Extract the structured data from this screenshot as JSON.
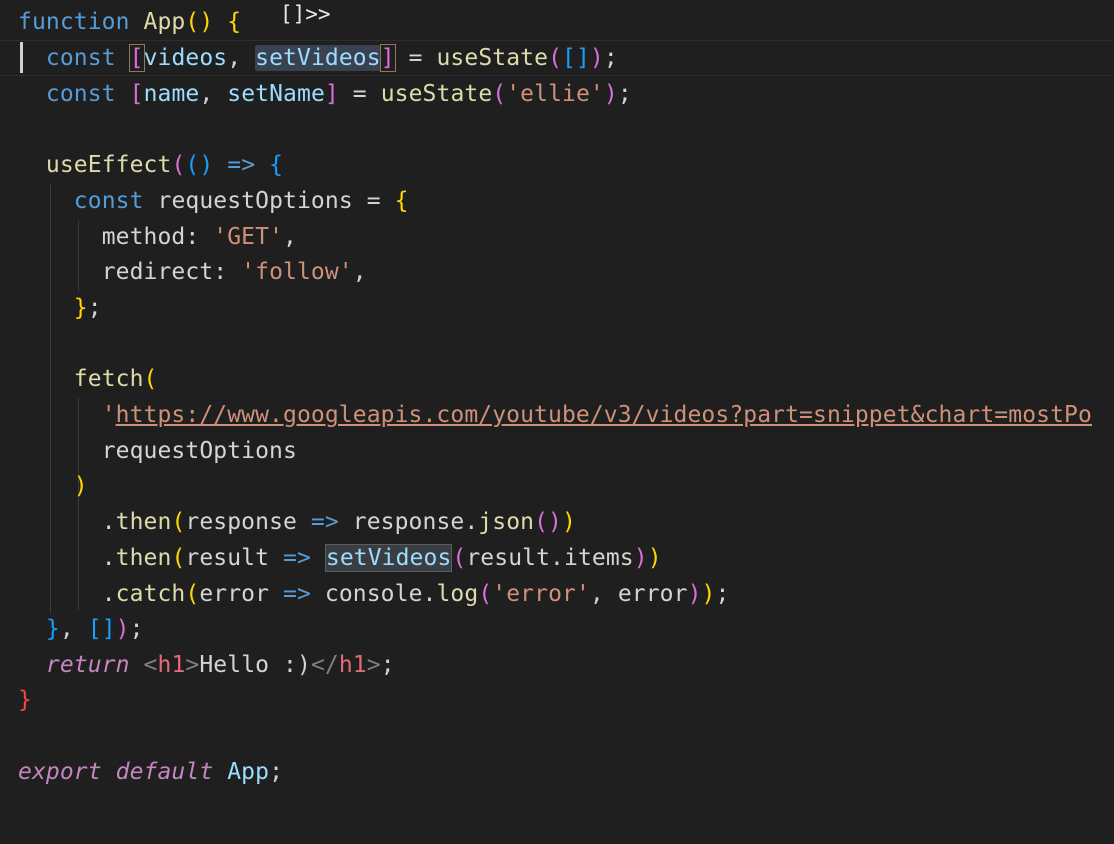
{
  "editor": {
    "inline_hint": "[]>>",
    "colors": {
      "background": "#1f1f1f",
      "keyword": "#569cd6",
      "function": "#dcdcaa",
      "variable": "#9cdcfe",
      "string": "#ce9178",
      "bracket_gold": "#ffd700",
      "bracket_purple": "#da70d6",
      "bracket_blue": "#179fff",
      "unmatched_brace": "#f44747"
    }
  },
  "code": {
    "l1": {
      "kw": "function",
      "name": "App",
      "open": "()",
      "brace": "{"
    },
    "l2": {
      "kw": "const",
      "open": "[",
      "a": "videos",
      "comma": ", ",
      "b": "setVideos",
      "close": "]",
      "eq": " = ",
      "fn": "useState",
      "p1": "(",
      "arr": "[]",
      "p2": ")",
      "semi": ";"
    },
    "l3": {
      "kw": "const",
      "open": "[",
      "a": "name",
      "comma": ", ",
      "b": "setName",
      "close": "]",
      "eq": " = ",
      "fn": "useState",
      "p1": "(",
      "str": "'ellie'",
      "p2": ")",
      "semi": ";"
    },
    "l5": {
      "fn": "useEffect",
      "p1": "(",
      "args": "()",
      "arrow": " => ",
      "brace": "{"
    },
    "l6": {
      "kw": "const",
      "name": "requestOptions",
      "eq": " = ",
      "brace": "{"
    },
    "l7": {
      "key": "method",
      "colon": ": ",
      "str": "'GET'",
      "comma": ","
    },
    "l8": {
      "key": "redirect",
      "colon": ": ",
      "str": "'follow'",
      "comma": ","
    },
    "l9": {
      "brace": "}",
      "semi": ";"
    },
    "l11": {
      "fn": "fetch",
      "p1": "("
    },
    "l12": {
      "quote": "'",
      "url": "https://www.googleapis.com/youtube/v3/videos?part=snippet&chart=mostPo"
    },
    "l13": {
      "arg": "requestOptions"
    },
    "l14": {
      "p2": ")"
    },
    "l15": {
      "dot": ".",
      "fn": "then",
      "p1": "(",
      "arg": "response",
      "arrow": " => ",
      "obj": "response",
      "dot2": ".",
      "fn2": "json",
      "call": "()",
      "p2": ")"
    },
    "l16": {
      "dot": ".",
      "fn": "then",
      "p1": "(",
      "arg": "result",
      "arrow": " => ",
      "fn2": "setVideos",
      "p3": "(",
      "obj": "result",
      "dot2": ".",
      "prop": "items",
      "p4": ")",
      "p2": ")"
    },
    "l17": {
      "dot": ".",
      "fn": "catch",
      "p1": "(",
      "arg": "error",
      "arrow": " => ",
      "obj": "console",
      "dot2": ".",
      "fn2": "log",
      "p3": "(",
      "str": "'error'",
      "comma": ", ",
      "arg2": "error",
      "p4": ")",
      "p2": ")",
      "semi": ";"
    },
    "l18": {
      "brace": "}",
      "comma": ", ",
      "arr": "[]",
      "p2": ")",
      "semi": ";"
    },
    "l19": {
      "kw": "return",
      "lt": "<",
      "tag": "h1",
      "gt": ">",
      "text": "Hello :)",
      "lt2": "</",
      "tag2": "h1",
      "gt2": ">",
      "semi": ";"
    },
    "l20": {
      "brace": "}"
    },
    "l22": {
      "kw1": "export",
      "kw2": "default",
      "name": "App",
      "semi": ";"
    }
  }
}
